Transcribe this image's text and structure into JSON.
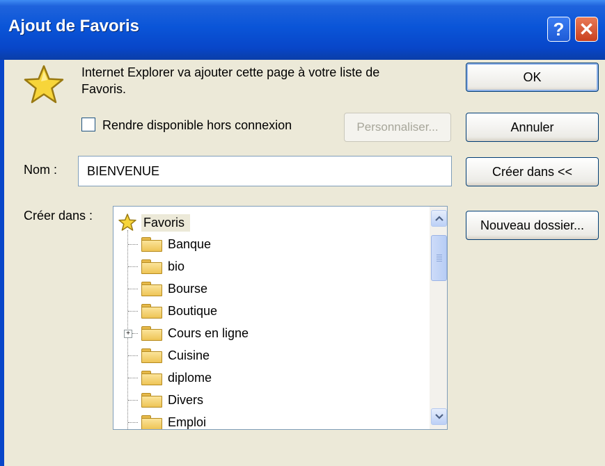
{
  "window": {
    "title": "Ajout de Favoris",
    "help_glyph": "?",
    "close_glyph": "✕"
  },
  "message": {
    "line1": "Internet Explorer va ajouter cette page à votre liste de",
    "line2": "Favoris."
  },
  "offline": {
    "label": "Rendre disponible hors connexion",
    "checked": false,
    "customize_label": "Personnaliser..."
  },
  "buttons": {
    "ok": "OK",
    "cancel": "Annuler",
    "create_in": "Créer dans <<",
    "new_folder": "Nouveau dossier..."
  },
  "name_field": {
    "label": "Nom :",
    "value": "BIENVENUE"
  },
  "create_in": {
    "label": "Créer dans :",
    "root": "Favoris",
    "folders": [
      {
        "name": "Banque",
        "expandable": false
      },
      {
        "name": "bio",
        "expandable": false
      },
      {
        "name": "Bourse",
        "expandable": false
      },
      {
        "name": "Boutique",
        "expandable": false
      },
      {
        "name": "Cours en ligne",
        "expandable": true
      },
      {
        "name": "Cuisine",
        "expandable": false
      },
      {
        "name": "diplome",
        "expandable": false
      },
      {
        "name": "Divers",
        "expandable": false
      },
      {
        "name": "Emploi",
        "expandable": false
      }
    ]
  },
  "icons": {
    "star": "star-icon",
    "folder": "folder-icon",
    "scroll_up": "chevron-up-icon",
    "scroll_down": "chevron-down-icon"
  },
  "colors": {
    "titlebar": "#0a55d8",
    "dialog_bg": "#ece9d8",
    "close_button": "#c9401f"
  }
}
